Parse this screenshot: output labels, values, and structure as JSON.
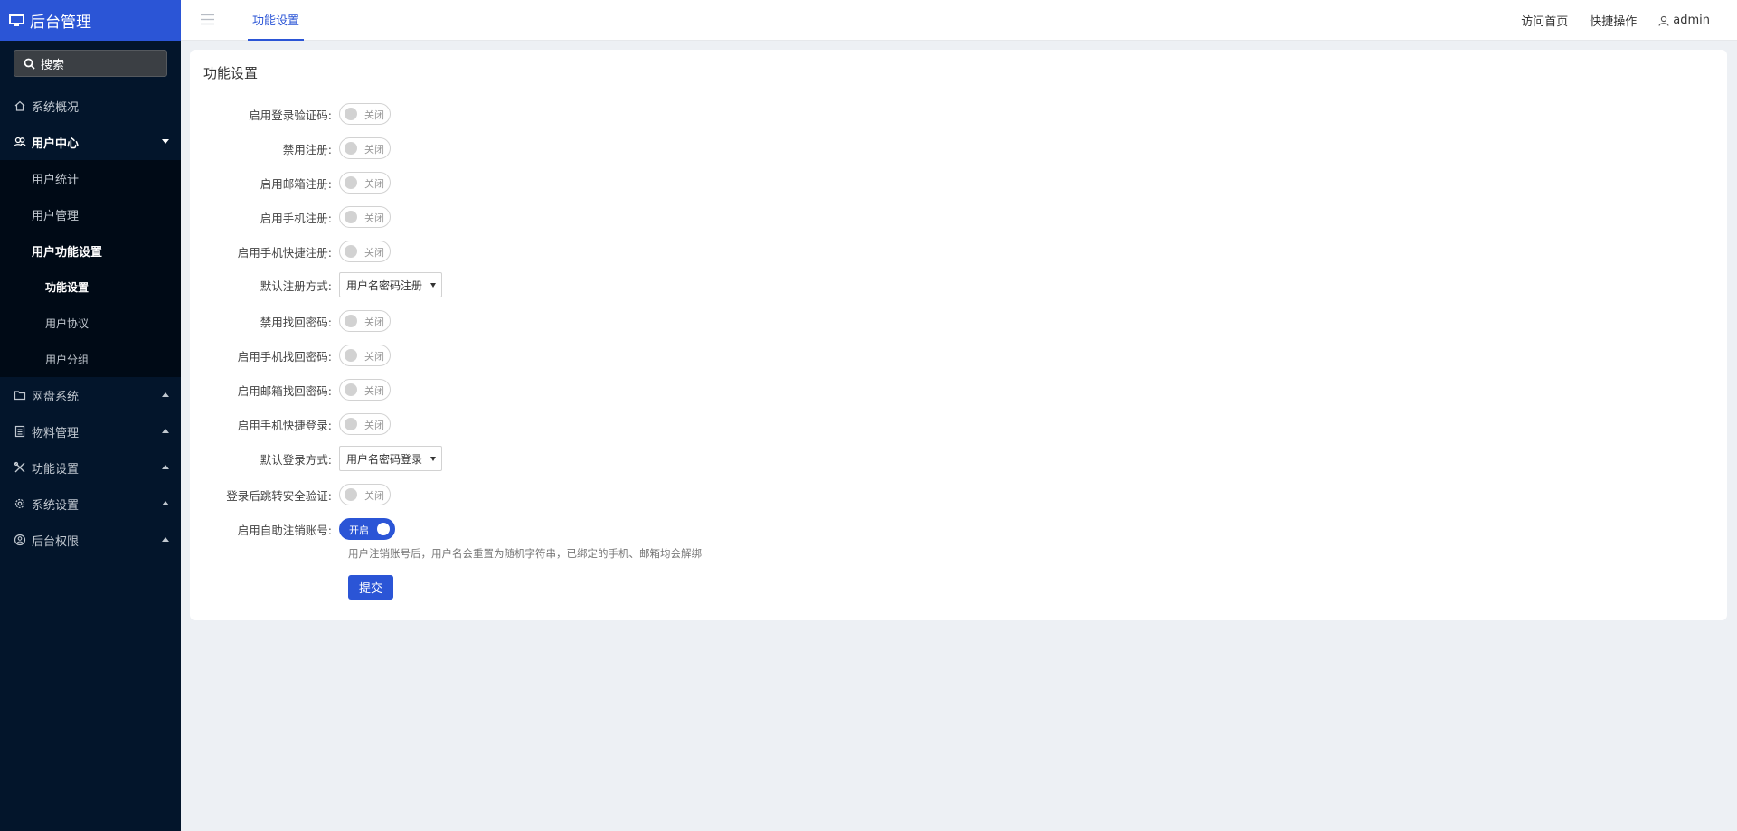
{
  "app": {
    "title": "后台管理"
  },
  "search": {
    "placeholder": "搜索"
  },
  "sidebar": {
    "items": [
      {
        "label": "系统概况"
      },
      {
        "label": "用户中心"
      },
      {
        "label": "网盘系统"
      },
      {
        "label": "物料管理"
      },
      {
        "label": "功能设置"
      },
      {
        "label": "系统设置"
      },
      {
        "label": "后台权限"
      }
    ],
    "user_center": {
      "sub_items": [
        {
          "label": "用户统计"
        },
        {
          "label": "用户管理"
        },
        {
          "label": "用户功能设置"
        }
      ],
      "user_func_sub_items": [
        {
          "label": "功能设置"
        },
        {
          "label": "用户协议"
        },
        {
          "label": "用户分组"
        }
      ]
    }
  },
  "topbar": {
    "active_tab": "功能设置",
    "visit_home": "访问首页",
    "quick_ops": "快捷操作",
    "username": "admin"
  },
  "form": {
    "title": "功能设置",
    "rows": [
      {
        "label": "启用登录验证码:",
        "state": "关闭"
      },
      {
        "label": "禁用注册:",
        "state": "关闭"
      },
      {
        "label": "启用邮箱注册:",
        "state": "关闭"
      },
      {
        "label": "启用手机注册:",
        "state": "关闭"
      },
      {
        "label": "启用手机快捷注册:",
        "state": "关闭"
      },
      {
        "label": "默认注册方式:",
        "value": "用户名密码注册"
      },
      {
        "label": "禁用找回密码:",
        "state": "关闭"
      },
      {
        "label": "启用手机找回密码:",
        "state": "关闭"
      },
      {
        "label": "启用邮箱找回密码:",
        "state": "关闭"
      },
      {
        "label": "启用手机快捷登录:",
        "state": "关闭"
      },
      {
        "label": "默认登录方式:",
        "value": "用户名密码登录"
      },
      {
        "label": "登录后跳转安全验证:",
        "state": "关闭"
      },
      {
        "label": "启用自助注销账号:",
        "state": "开启"
      }
    ],
    "hint": "用户注销账号后，用户名会重置为随机字符串，已绑定的手机、邮箱均会解绑",
    "submit_label": "提交"
  },
  "colors": {
    "accent": "#2b55d6",
    "sidebar_bg": "#03152b",
    "submenu_bg": "#000a16",
    "page_bg": "#edf0f4"
  }
}
